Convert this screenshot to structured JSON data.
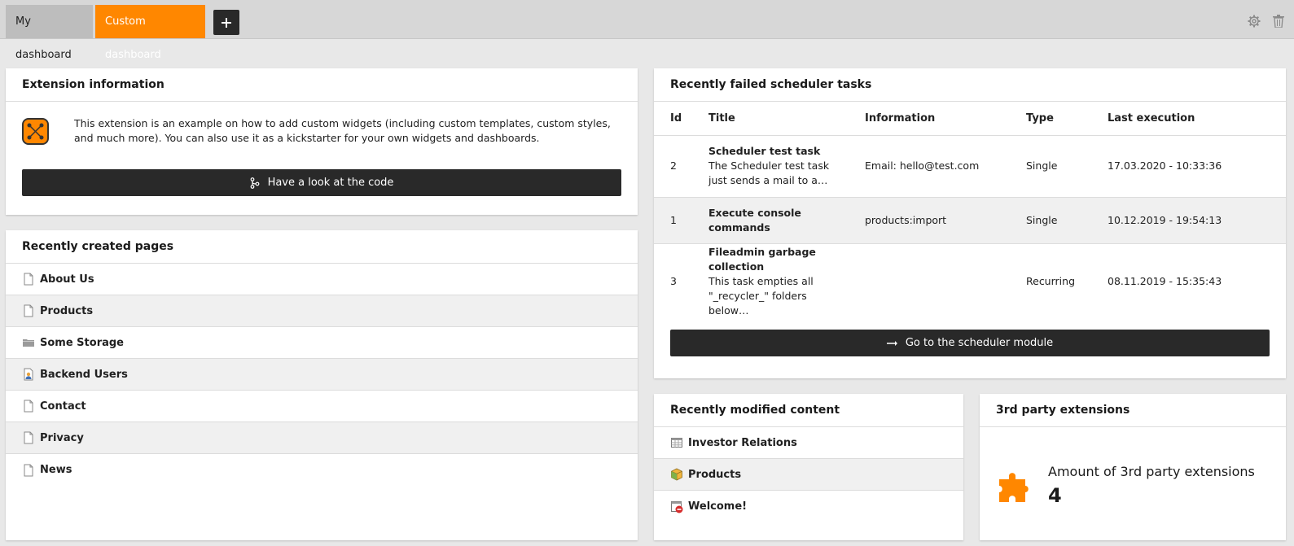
{
  "tabs": {
    "items": [
      {
        "label": "My dashboard"
      },
      {
        "label": "Custom dashboard"
      }
    ],
    "add_icon": "plus-icon"
  },
  "top_actions": {
    "settings_icon": "gear-icon",
    "delete_icon": "trash-icon"
  },
  "extension_info": {
    "title": "Extension information",
    "description": "This extension is an example on how to add custom widgets (including custom templates, custom styles, and much more). You can also use it as a kickstarter for your own widgets and dashboards.",
    "button_label": "Have a look at the code"
  },
  "recent_pages": {
    "title": "Recently created pages",
    "items": [
      {
        "label": "About Us",
        "icon": "page-icon"
      },
      {
        "label": "Products",
        "icon": "page-icon"
      },
      {
        "label": "Some Storage",
        "icon": "folder-icon"
      },
      {
        "label": "Backend Users",
        "icon": "users-page-icon"
      },
      {
        "label": "Contact",
        "icon": "page-icon"
      },
      {
        "label": "Privacy",
        "icon": "page-icon"
      },
      {
        "label": "News",
        "icon": "page-icon"
      }
    ]
  },
  "scheduler": {
    "title": "Recently failed scheduler tasks",
    "columns": [
      "Id",
      "Title",
      "Information",
      "Type",
      "Last execution"
    ],
    "rows": [
      {
        "id": "2",
        "title": "Scheduler test task",
        "desc": "The Scheduler test task just sends a mail to a…",
        "information": "Email: hello@test.com",
        "type": "Single",
        "last": "17.03.2020 - 10:33:36"
      },
      {
        "id": "1",
        "title": "Execute console commands",
        "desc": "",
        "information": "products:import",
        "type": "Single",
        "last": "10.12.2019 - 19:54:13"
      },
      {
        "id": "3",
        "title": "Fileadmin garbage collection",
        "desc": "This task empties all \"_recycler_\" folders below…",
        "information": "",
        "type": "Recurring",
        "last": "08.11.2019 - 15:35:43"
      }
    ],
    "button_label": "Go to the scheduler module"
  },
  "modified_content": {
    "title": "Recently modified content",
    "items": [
      {
        "label": "Investor Relations",
        "icon": "table-content-icon"
      },
      {
        "label": "Products",
        "icon": "box-content-icon"
      },
      {
        "label": "Welcome!",
        "icon": "hidden-content-icon"
      }
    ]
  },
  "third_party": {
    "title": "3rd party extensions",
    "label": "Amount of 3rd party extensions",
    "count": "4",
    "icon": "puzzle-icon"
  },
  "colors": {
    "accent": "#ff8700",
    "dark": "#292929"
  }
}
